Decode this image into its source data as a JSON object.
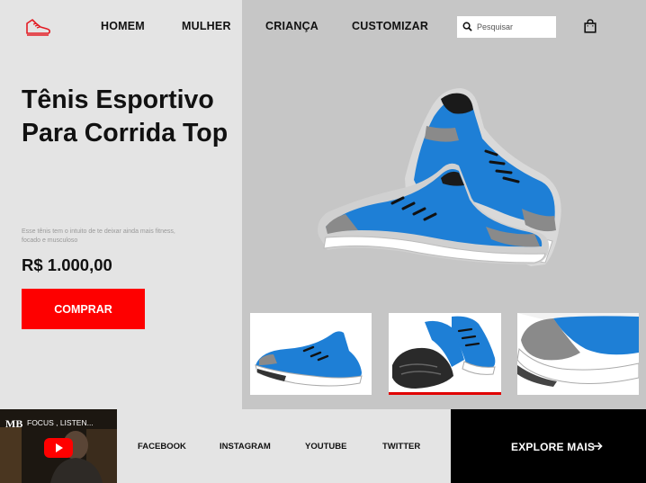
{
  "header": {
    "logo_icon": "sneaker-logo-icon",
    "nav": [
      "HOMEM",
      "MULHER",
      "CRIANÇA",
      "CUSTOMIZAR"
    ],
    "search": {
      "placeholder": "Pesquisar",
      "icon": "search-icon"
    },
    "cart_icon": "shopping-bag-icon"
  },
  "product": {
    "title": "Tênis Esportivo Para Corrida Top",
    "description": "Esse tênis tem o intuito de te deixar ainda mais fitness, focado e musculoso",
    "price": "R$ 1.000,00",
    "buy_label": "COMPRAR"
  },
  "gallery": {
    "active_index": 1,
    "shoe_color": "#1e7fd6",
    "accent": "#e00000"
  },
  "video": {
    "channel": "MB",
    "title": "FOCUS , LISTEN..."
  },
  "social": [
    "FACEBOOK",
    "INSTAGRAM",
    "YOUTUBE",
    "TWITTER"
  ],
  "explore": {
    "label": "EXPLORE MAIS",
    "icon": "arrow-right-icon"
  }
}
